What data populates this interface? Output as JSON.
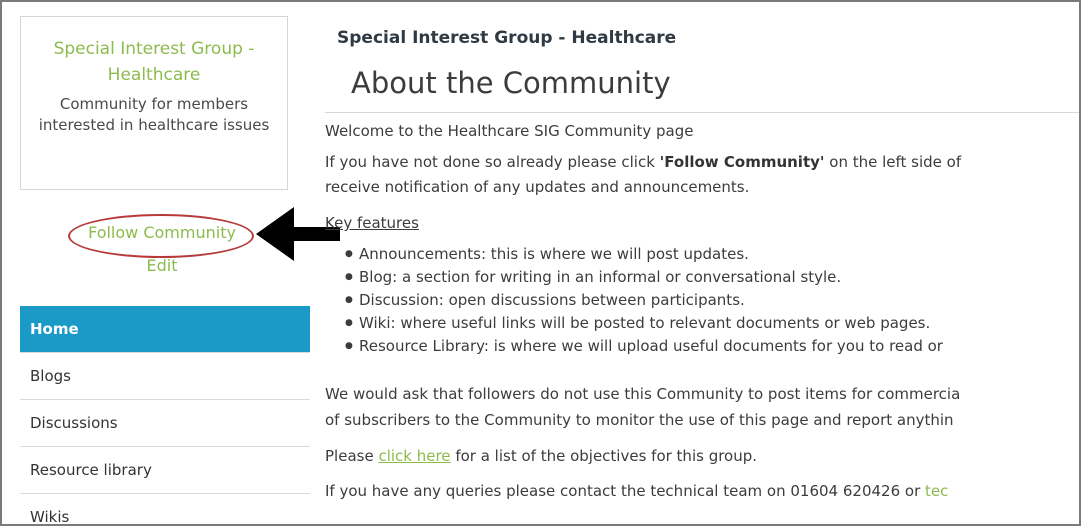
{
  "sidebar": {
    "community_title": "Special Interest Group - Healthcare",
    "community_description": "Community for members interested in healthcare issues",
    "follow_label": "Follow Community",
    "edit_label": "Edit",
    "nav_items": [
      "Home",
      "Blogs",
      "Discussions",
      "Resource library",
      "Wikis"
    ],
    "active_item": "Home"
  },
  "main": {
    "group_heading": "Special Interest Group - Healthcare",
    "page_title": "About the Community",
    "welcome": "Welcome to the Healthcare SIG Community page",
    "follow_line_pre": "If you have not done so already please click ",
    "follow_line_bold": "'Follow Community'",
    "follow_line_post": " on the left side of",
    "follow_line2": "receive notification of any updates and announcements.",
    "key_features": "Key features",
    "features": [
      "Announcements: this is where we will post updates.",
      "Blog: a section for writing in an informal or conversational style.",
      "Discussion: open discussions between participants.",
      "Wiki: where useful links will be posted to relevant documents or web pages.",
      "Resource Library: is where we will upload useful documents for you to read or"
    ],
    "ask_line1": "We would ask that followers do not use this Community to post items for commercia",
    "ask_line2": "of subscribers to the Community to monitor the use of this page and report anythin",
    "please_pre": "Please ",
    "click_here": "click here",
    "please_post": " for a list of the objectives for this group.",
    "queries_pre": "If you have any queries please contact the technical team on 01604 620426 or ",
    "queries_link": "tec"
  },
  "colors": {
    "accent_green": "#8dbb4d",
    "nav_active_blue": "#1b9ac8",
    "highlight_red": "#b73a3a"
  }
}
